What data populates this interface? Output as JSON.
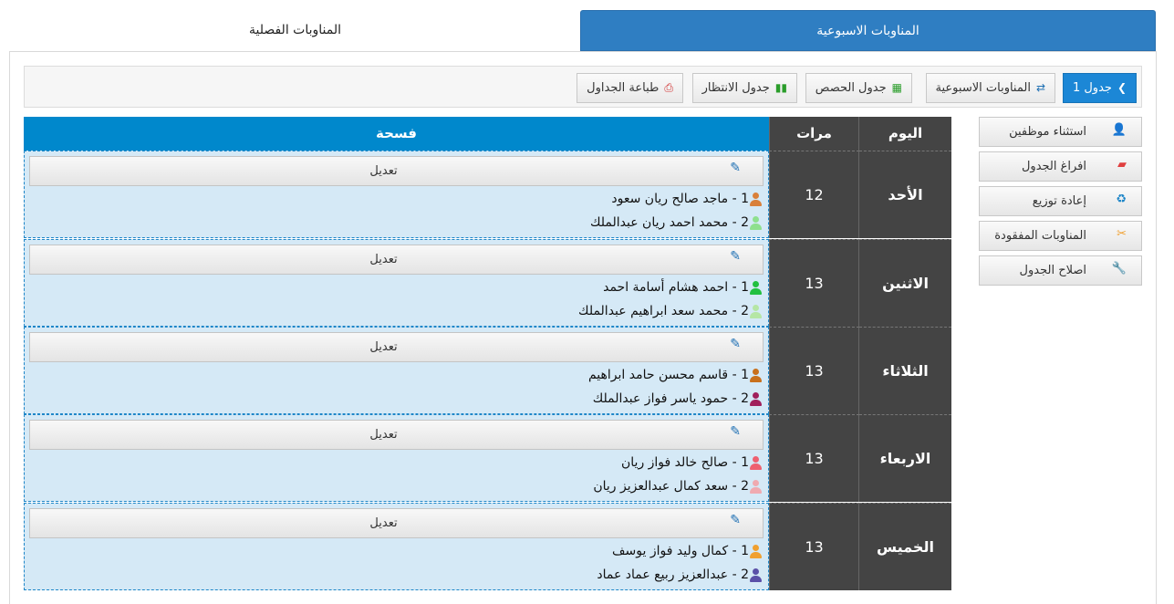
{
  "tabs": {
    "weekly": "المناوبات الاسبوعية",
    "semester": "المناوبات الفصلية"
  },
  "toolbar": {
    "schedule": "جدول 1",
    "weekly": "المناوبات الاسبوعية",
    "periods": "جدول الحصص",
    "waiting": "جدول الانتظار",
    "print": "طباعة الجداول"
  },
  "side_actions": [
    {
      "label": "استثناء موظفين",
      "icon": "user-remove-icon",
      "color": "#f0a030"
    },
    {
      "label": "افراغ الجدول",
      "icon": "eraser-icon",
      "color": "#e04040"
    },
    {
      "label": "إعادة توزيع",
      "icon": "recycle-icon",
      "color": "#1e86c8"
    },
    {
      "label": "المناوبات المفقودة",
      "icon": "broken-link-icon",
      "color": "#f0a030"
    },
    {
      "label": "اصلاح الجدول",
      "icon": "wrench-icon",
      "color": "#1e6fb3"
    }
  ],
  "table": {
    "headers": {
      "day": "اليوم",
      "count": "مرات",
      "main": "فسحة"
    },
    "edit_label": "تعديل",
    "rows": [
      {
        "day": "الأحد",
        "count": "12",
        "people": [
          {
            "text": "1 - ماجد صالح ريان سعود",
            "color": "#d9803a"
          },
          {
            "text": "2 - محمد احمد ريان عبدالملك",
            "color": "#8ee08e"
          }
        ]
      },
      {
        "day": "الاثنين",
        "count": "13",
        "people": [
          {
            "text": "1 - احمد هشام أسامة احمد",
            "color": "#22c040"
          },
          {
            "text": "2 - محمد سعد ابراهيم عبدالملك",
            "color": "#b5e6a5"
          }
        ]
      },
      {
        "day": "الثلاثاء",
        "count": "13",
        "people": [
          {
            "text": "1 - قاسم محسن حامد ابراهيم",
            "color": "#c8701c"
          },
          {
            "text": "2 - حمود ياسر فواز عبدالملك",
            "color": "#a0205c"
          }
        ]
      },
      {
        "day": "الاربعاء",
        "count": "13",
        "people": [
          {
            "text": "1 - صالح خالد فواز ريان",
            "color": "#ee6070"
          },
          {
            "text": "2 - سعد كمال عبدالعزيز ريان",
            "color": "#f0aab0"
          }
        ]
      },
      {
        "day": "الخميس",
        "count": "13",
        "people": [
          {
            "text": "1 - كمال وليد فواز يوسف",
            "color": "#f0a030"
          },
          {
            "text": "2 - عبدالعزيز ربيع عماد عماد",
            "color": "#5a50a8"
          }
        ]
      }
    ]
  }
}
